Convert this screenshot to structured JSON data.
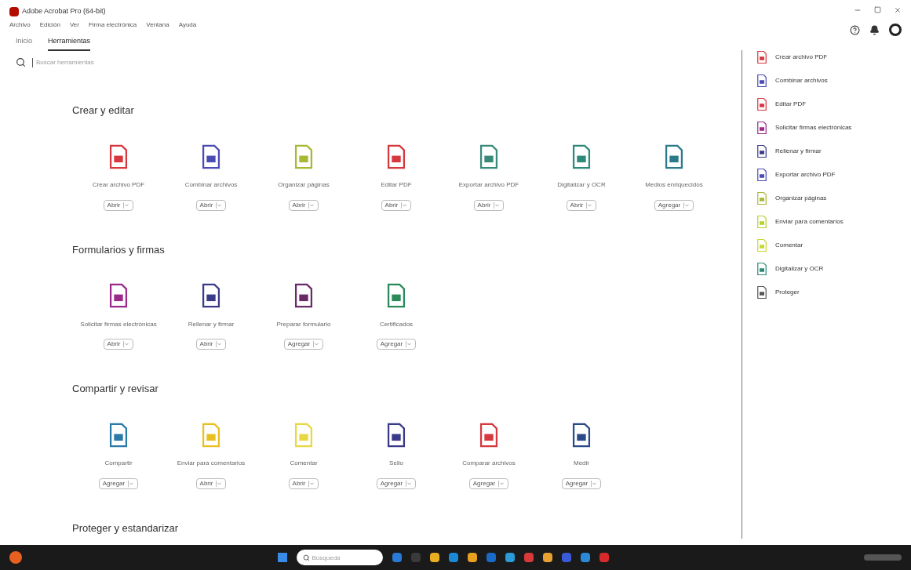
{
  "window": {
    "title": "Adobe Acrobat Pro (64-bit)"
  },
  "menu": [
    "Archivo",
    "Edición",
    "Ver",
    "Firma electrónica",
    "Ventana",
    "Ayuda"
  ],
  "tabs": [
    {
      "label": "Inicio",
      "selected": false
    },
    {
      "label": "Herramientas",
      "selected": true
    }
  ],
  "search": {
    "placeholder": "Buscar herramientas"
  },
  "sections": [
    {
      "title": "Crear y editar",
      "tools": [
        {
          "label": "Crear archivo PDF",
          "action": "Abrir",
          "color": "#d7373f"
        },
        {
          "label": "Combinar archivos",
          "action": "Abrir",
          "color": "#4b4bb4"
        },
        {
          "label": "Organizar páginas",
          "action": "Abrir",
          "color": "#a8b832"
        },
        {
          "label": "Editar PDF",
          "action": "Abrir",
          "color": "#d7373f"
        },
        {
          "label": "Exportar archivo PDF",
          "action": "Abrir",
          "color": "#3a8a7a"
        },
        {
          "label": "Digitalizar y OCR",
          "action": "Abrir",
          "color": "#2d8a78"
        },
        {
          "label": "Medios enriquecidos",
          "action": "Agregar",
          "color": "#2a7a8a"
        }
      ]
    },
    {
      "title": "Formularios y firmas",
      "tools": [
        {
          "label": "Solicitar firmas electrónicas",
          "action": "Abrir",
          "color": "#9b2a8a"
        },
        {
          "label": "Rellenar y firmar",
          "action": "Abrir",
          "color": "#3a3a8a"
        },
        {
          "label": "Preparar formulario",
          "action": "Agregar",
          "color": "#6a2a6a"
        },
        {
          "label": "Certificados",
          "action": "Agregar",
          "color": "#2a8a5a"
        }
      ]
    },
    {
      "title": "Compartir y revisar",
      "tools": [
        {
          "label": "Compartir",
          "action": "Agregar",
          "color": "#2a7aa8"
        },
        {
          "label": "Enviar para comentarios",
          "action": "Abrir",
          "color": "#e8c020"
        },
        {
          "label": "Comentar",
          "action": "Abrir",
          "color": "#e8d840"
        },
        {
          "label": "Sello",
          "action": "Agregar",
          "color": "#3a3a8a"
        },
        {
          "label": "Comparar archivos",
          "action": "Agregar",
          "color": "#d7373f"
        },
        {
          "label": "Medir",
          "action": "Agregar",
          "color": "#2a4a8a"
        }
      ]
    },
    {
      "title": "Proteger y estandarizar"
    }
  ],
  "panel": [
    {
      "label": "Crear archivo PDF",
      "color": "#d7373f"
    },
    {
      "label": "Combinar archivos",
      "color": "#4b4bb4"
    },
    {
      "label": "Editar PDF",
      "color": "#d7373f"
    },
    {
      "label": "Solicitar firmas electrónicas",
      "color": "#9b2a8a"
    },
    {
      "label": "Rellenar y firmar",
      "color": "#3a3a8a"
    },
    {
      "label": "Exportar archivo PDF",
      "color": "#4b4bb4"
    },
    {
      "label": "Organizar páginas",
      "color": "#a8b832"
    },
    {
      "label": "Enviar para comentarios",
      "color": "#b8d030"
    },
    {
      "label": "Comentar",
      "color": "#c8d830"
    },
    {
      "label": "Digitalizar y OCR",
      "color": "#2d8a78"
    },
    {
      "label": "Proteger",
      "color": "#555555"
    }
  ],
  "taskbar": {
    "search_placeholder": "Búsqueda",
    "apps": [
      {
        "color": "#2a7ad8"
      },
      {
        "color": "#3a3a3a"
      },
      {
        "color": "#e8b020"
      },
      {
        "color": "#1a8ad8"
      },
      {
        "color": "#e8a020"
      },
      {
        "color": "#1a6ac8"
      },
      {
        "color": "#2a9ad8"
      },
      {
        "color": "#d83a3a"
      },
      {
        "color": "#e8a030"
      },
      {
        "color": "#3a5ad8"
      },
      {
        "color": "#2a8ad8"
      },
      {
        "color": "#d82a2a"
      }
    ]
  }
}
